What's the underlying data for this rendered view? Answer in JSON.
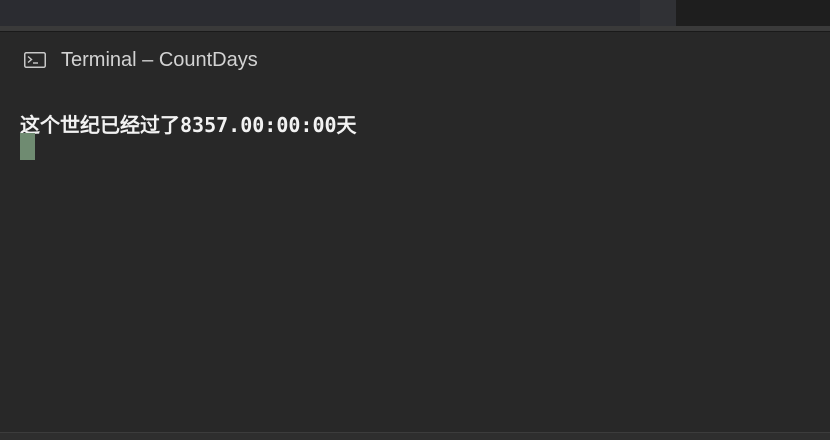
{
  "panel": {
    "title": "Terminal – CountDays",
    "icon": "terminal-icon"
  },
  "terminal": {
    "output_line": "这个世纪已经过了8357.00:00:00天",
    "cursor_color": "#6f8b71"
  },
  "colors": {
    "background": "#282828",
    "text": "#f2f2f2",
    "title": "#d3d3d3"
  }
}
